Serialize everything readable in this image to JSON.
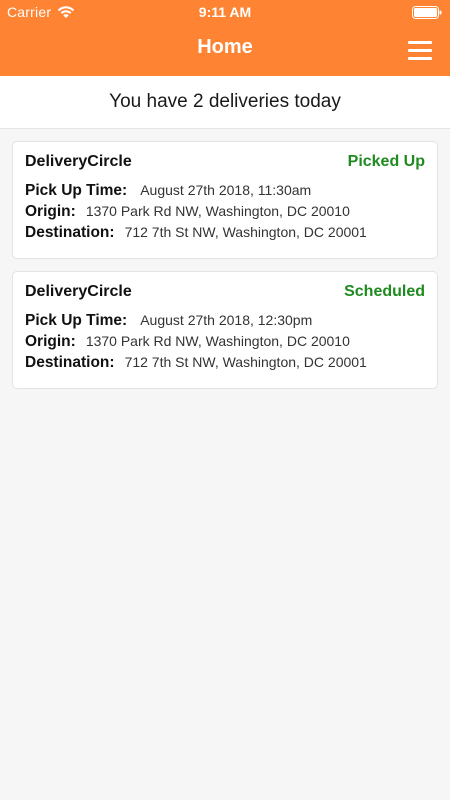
{
  "status_bar": {
    "carrier": "Carrier",
    "time": "9:11 AM"
  },
  "header": {
    "title": "Home",
    "menu_icon": "hamburger-menu-icon",
    "background_color": "#fe8433"
  },
  "summary": {
    "text": "You have 2 deliveries today"
  },
  "labels": {
    "pickup_time": "Pick Up Time:",
    "origin": "Origin:",
    "destination": "Destination:"
  },
  "deliveries": [
    {
      "company": "DeliveryCircle",
      "status": "Picked Up",
      "pickup_time": "August 27th 2018, 11:30am",
      "origin": "1370 Park Rd NW, Washington, DC 20010",
      "destination": "712 7th St NW, Washington, DC 20001"
    },
    {
      "company": "DeliveryCircle",
      "status": "Scheduled",
      "pickup_time": "August 27th 2018, 12:30pm",
      "origin": "1370 Park Rd NW, Washington, DC 20010",
      "destination": "712 7th St NW, Washington, DC 20001"
    }
  ],
  "colors": {
    "status_green": "#1f8a1f",
    "card_background": "#ffffff",
    "page_background": "#f6f6f6"
  }
}
